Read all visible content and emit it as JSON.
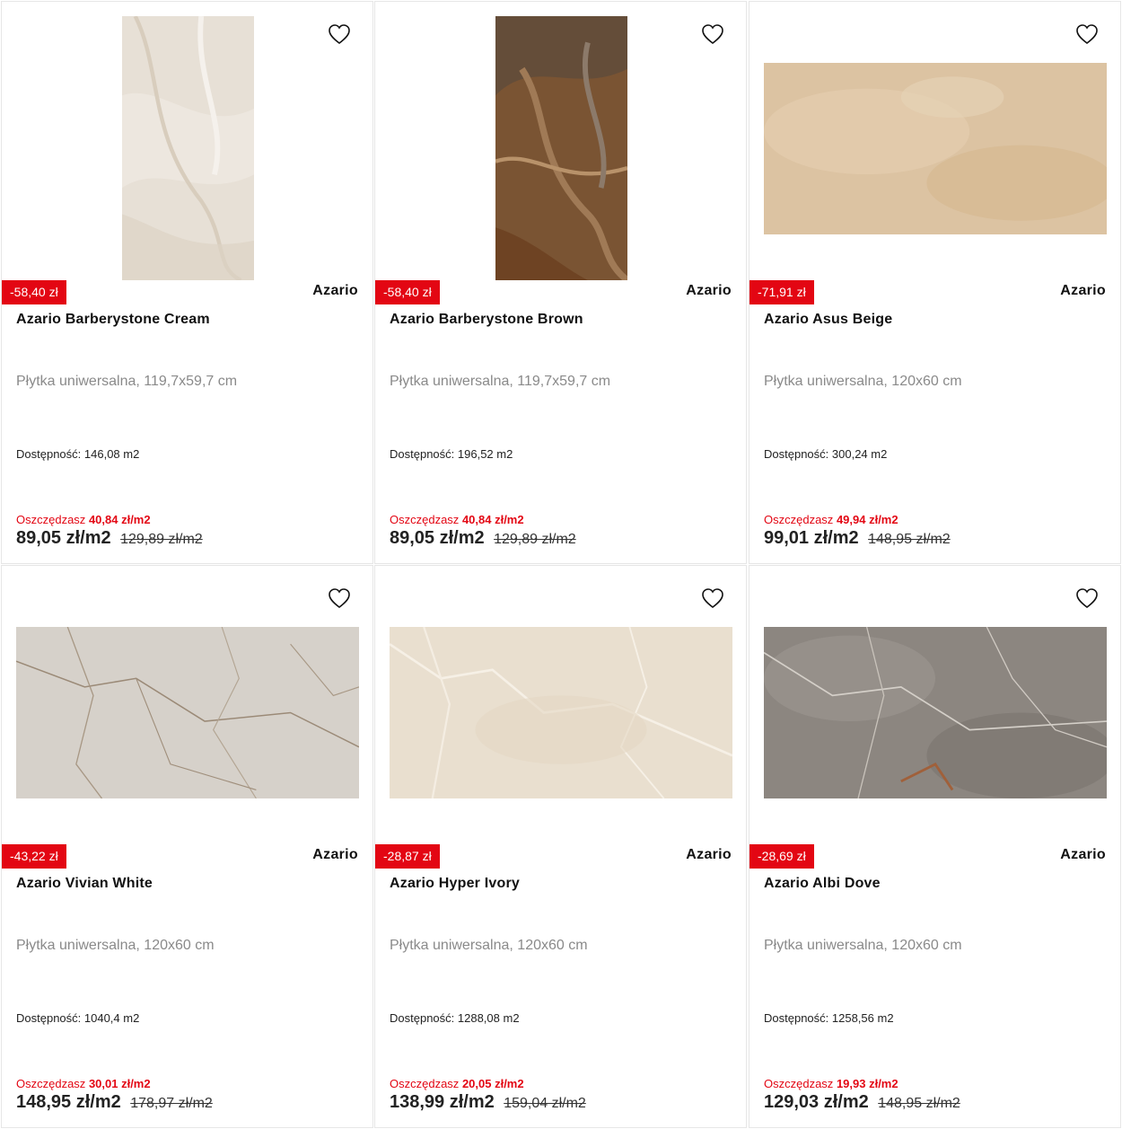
{
  "colors": {
    "accent_red": "#e30613",
    "card_border": "#e6e6e6",
    "text_muted": "#8a8a8a"
  },
  "icons": {
    "favorite": "heart-outline-icon"
  },
  "products": [
    {
      "discount": "-58,40 zł",
      "brand": "Azario",
      "name": "Azario Barberystone Cream",
      "description": "Płytka uniwersalna, 119,7x59,7 cm",
      "availability_label": "Dostępność:",
      "availability_value": "146,08 m2",
      "save_label": "Oszczędzasz",
      "save_value": "40,84 zł/m2",
      "price": "89,05 zł/m2",
      "old_price": "129,89 zł/m2",
      "image_orientation": "portrait",
      "tile_color": "#e7e0d6"
    },
    {
      "discount": "-58,40 zł",
      "brand": "Azario",
      "name": "Azario Barberystone Brown",
      "description": "Płytka uniwersalna, 119,7x59,7 cm",
      "availability_label": "Dostępność:",
      "availability_value": "196,52 m2",
      "save_label": "Oszczędzasz",
      "save_value": "40,84 zł/m2",
      "price": "89,05 zł/m2",
      "old_price": "129,89 zł/m2",
      "image_orientation": "portrait",
      "tile_color": "#7a5433"
    },
    {
      "discount": "-71,91 zł",
      "brand": "Azario",
      "name": "Azario Asus Beige",
      "description": "Płytka uniwersalna, 120x60 cm",
      "availability_label": "Dostępność:",
      "availability_value": "300,24 m2",
      "save_label": "Oszczędzasz",
      "save_value": "49,94 zł/m2",
      "price": "99,01 zł/m2",
      "old_price": "148,95 zł/m2",
      "image_orientation": "landscape",
      "tile_color": "#dcc3a2"
    },
    {
      "discount": "-43,22 zł",
      "brand": "Azario",
      "name": "Azario Vivian White",
      "description": "Płytka uniwersalna, 120x60 cm",
      "availability_label": "Dostępność:",
      "availability_value": "1040,4 m2",
      "save_label": "Oszczędzasz",
      "save_value": "30,01 zł/m2",
      "price": "148,95 zł/m2",
      "old_price": "178,97 zł/m2",
      "image_orientation": "landscape",
      "tile_color": "#d6d1ca"
    },
    {
      "discount": "-28,87 zł",
      "brand": "Azario",
      "name": "Azario Hyper Ivory",
      "description": "Płytka uniwersalna, 120x60 cm",
      "availability_label": "Dostępność:",
      "availability_value": "1288,08 m2",
      "save_label": "Oszczędzasz",
      "save_value": "20,05 zł/m2",
      "price": "138,99 zł/m2",
      "old_price": "159,04 zł/m2",
      "image_orientation": "landscape",
      "tile_color": "#e9dfcf"
    },
    {
      "discount": "-28,69 zł",
      "brand": "Azario",
      "name": "Azario Albi Dove",
      "description": "Płytka uniwersalna, 120x60 cm",
      "availability_label": "Dostępność:",
      "availability_value": "1258,56 m2",
      "save_label": "Oszczędzasz",
      "save_value": "19,93 zł/m2",
      "price": "129,03 zł/m2",
      "old_price": "148,95 zł/m2",
      "image_orientation": "landscape",
      "tile_color": "#8c8680"
    }
  ]
}
